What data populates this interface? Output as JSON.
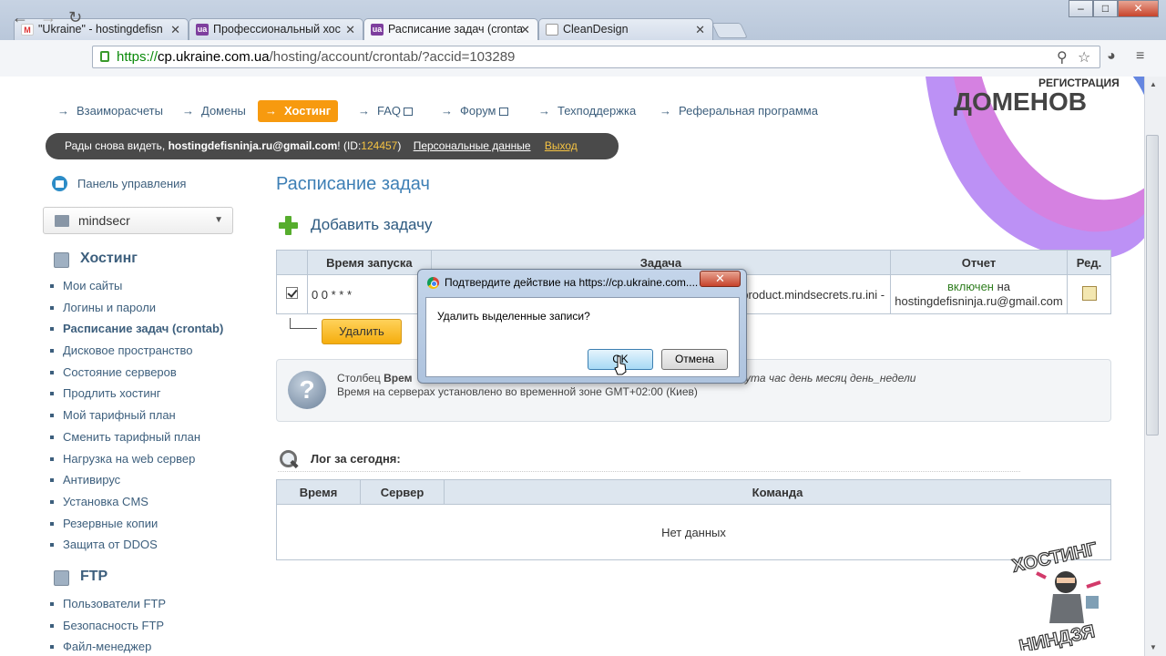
{
  "browser": {
    "tabs": [
      {
        "label": "\"Ukraine\" - hostingdefisn",
        "icon": "gmail-icon"
      },
      {
        "label": "Профессиональный хос",
        "icon": "ua-icon"
      },
      {
        "label": "Расписание задач (cronta",
        "icon": "ua-icon"
      },
      {
        "label": "CleanDesign",
        "icon": "page-icon"
      }
    ],
    "url_scheme": "https://",
    "url_host": "cp.ukraine.com.ua",
    "url_path": "/hosting/account/crontab/?accid=103289",
    "window_buttons": [
      "–",
      "□",
      "✕"
    ]
  },
  "brand": {
    "line1": "РЕГИСТРАЦИЯ",
    "line2": "ДОМЕНОВ"
  },
  "topnav": {
    "items": [
      {
        "label": "Взаиморасчеты"
      },
      {
        "label": "Домены"
      },
      {
        "label": "Хостинг",
        "active": true
      },
      {
        "label": "FAQ"
      },
      {
        "label": "Форум"
      },
      {
        "label": "Техподдержка"
      },
      {
        "label": "Реферальная программа"
      }
    ],
    "arrow": "→"
  },
  "userbar": {
    "greeting": "Рады снова видеть,",
    "email": "hostingdefisninja.ru@gmail.com",
    "id_prefix": "! (ID:",
    "id": "124457",
    "id_suffix": ")",
    "personal": "Персональные данные",
    "logout": "Выход"
  },
  "sidebar": {
    "panel": "Панель управления",
    "account": "mindsecr",
    "hosting_title": "Хостинг",
    "hosting_items": [
      "Мои сайты",
      "Логины и пароли",
      "Расписание задач (crontab)",
      "Дисковое пространство",
      "Состояние серверов",
      "Продлить хостинг",
      "Мой тарифный план",
      "Сменить тарифный план",
      "Нагрузка на web сервер",
      "Антивирус",
      "Установка CMS",
      "Резервные копии",
      "Защита от DDOS"
    ],
    "ftp_title": "FTP",
    "ftp_items": [
      "Пользователи FTP",
      "Безопасность FTP",
      "Файл-менеджер"
    ]
  },
  "main": {
    "title": "Расписание задач",
    "add_task": "Добавить задачу",
    "table": {
      "headers": [
        "Время запуска",
        "Задача",
        "Отчет",
        "Ред."
      ],
      "row": {
        "time": "0 0 * * *",
        "task": "product.mindsecrets.ru.ini -",
        "report_status": "включен",
        "report_suffix": "на",
        "report_email": "hostingdefisninja.ru@gmail.com"
      }
    },
    "delete_label": "Удалить",
    "info": {
      "line1a": "Столбец",
      "line1b": "Врем",
      "line1c": "ута час день месяц день_недели",
      "line2": "Время на серверах установлено во временной зоне GMT+02:00 (Киев)"
    },
    "log_title": "Лог за сегодня:",
    "log_headers": [
      "Время",
      "Сервер",
      "Команда"
    ],
    "log_empty": "Нет данных"
  },
  "dialog": {
    "title": "Подтвердите действие на https://cp.ukraine.com....",
    "message": "Удалить выделенные записи?",
    "ok": "OK",
    "cancel": "Отмена",
    "close": "✕"
  },
  "logo": {
    "top": "ХОСТИНГ",
    "bottom": "НИНДЗЯ"
  },
  "colors": {
    "accent_orange": "#f79a0f",
    "link_blue": "#3d5f7d",
    "title_blue": "#3d7fb5",
    "report_green": "#2e7d1e"
  }
}
